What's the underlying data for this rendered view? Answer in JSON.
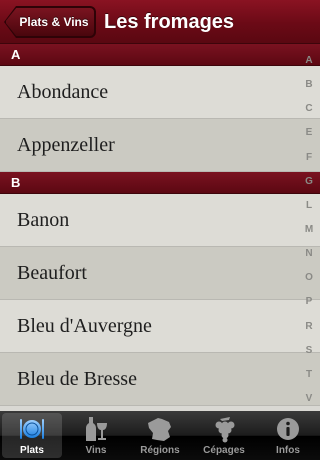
{
  "navbar": {
    "back_label": "Plats & Vins",
    "title": "Les fromages"
  },
  "sections": [
    {
      "header": "A",
      "rows": [
        "Abondance",
        "Appenzeller"
      ]
    },
    {
      "header": "B",
      "rows": [
        "Banon",
        "Beaufort",
        "Bleu d'Auvergne",
        "Bleu de Bresse"
      ]
    }
  ],
  "index": [
    "A",
    "B",
    "C",
    "E",
    "F",
    "G",
    "L",
    "M",
    "N",
    "O",
    "P",
    "R",
    "S",
    "T",
    "V"
  ],
  "tabs": [
    {
      "label": "Plats",
      "icon": "plate-cutlery-icon"
    },
    {
      "label": "Vins",
      "icon": "wine-bottle-glass-icon"
    },
    {
      "label": "Régions",
      "icon": "france-map-icon"
    },
    {
      "label": "Cépages",
      "icon": "grape-icon"
    },
    {
      "label": "Infos",
      "icon": "info-icon"
    }
  ],
  "colors": {
    "accent": "#6b0a16",
    "row_light": "#dddcd6",
    "row_dark": "#cbcac2",
    "tabbar": "#1c1c1c"
  }
}
